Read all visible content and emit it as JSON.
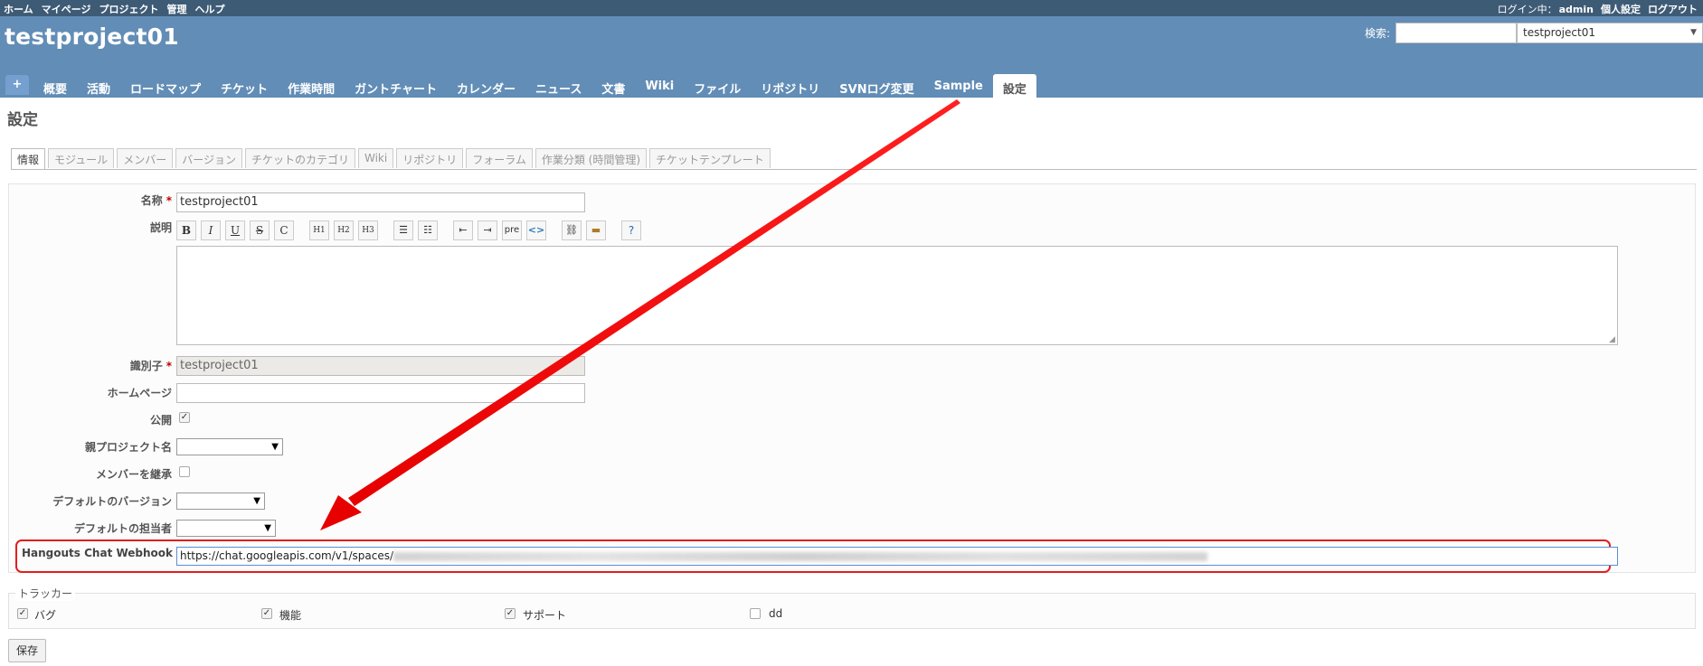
{
  "top_menu": {
    "items": [
      "ホーム",
      "マイページ",
      "プロジェクト",
      "管理",
      "ヘルプ"
    ],
    "login_text": "ログイン中：",
    "login_user": "admin",
    "my_account": "個人設定",
    "logout": "ログアウト"
  },
  "header": {
    "title": "testproject01",
    "search_label": "検索:",
    "search_value": "",
    "project_jump": "testproject01"
  },
  "main_menu": {
    "new_label": "+",
    "items": [
      "概要",
      "活動",
      "ロードマップ",
      "チケット",
      "作業時間",
      "ガントチャート",
      "カレンダー",
      "ニュース",
      "文書",
      "Wiki",
      "ファイル",
      "リポジトリ",
      "SVNログ変更",
      "Sample",
      "設定"
    ],
    "selected": "設定"
  },
  "page": {
    "title": "設定"
  },
  "tabs": {
    "items": [
      "情報",
      "モジュール",
      "メンバー",
      "バージョン",
      "チケットのカテゴリ",
      "Wiki",
      "リポジトリ",
      "フォーラム",
      "作業分類 (時間管理)",
      "チケットテンプレート"
    ],
    "selected": "情報"
  },
  "form": {
    "name": {
      "label": "名称",
      "required": "*",
      "value": "testproject01"
    },
    "description": {
      "label": "説明",
      "value": ""
    },
    "identifier": {
      "label": "識別子",
      "required": "*",
      "value": "testproject01"
    },
    "homepage": {
      "label": "ホームページ",
      "value": ""
    },
    "public": {
      "label": "公開",
      "checked": true
    },
    "parent": {
      "label": "親プロジェクト名",
      "value": ""
    },
    "inherit_members": {
      "label": "メンバーを継承",
      "checked": false
    },
    "default_version": {
      "label": "デフォルトのバージョン",
      "value": ""
    },
    "default_assignee": {
      "label": "デフォルトの担当者",
      "value": ""
    },
    "webhook": {
      "label": "Hangouts Chat Webhook",
      "value": "https://chat.googleapis.com/v1/spaces/"
    }
  },
  "toolbar": {
    "buttons": [
      "B",
      "I",
      "U",
      "S",
      "C",
      "H1",
      "H2",
      "H3",
      "ul",
      "ol",
      "indent-left",
      "indent-right",
      "pre",
      "code",
      "link",
      "image",
      "help"
    ]
  },
  "trackers": {
    "legend": "トラッカー",
    "items": [
      {
        "label": "バグ",
        "checked": true
      },
      {
        "label": "機能",
        "checked": true
      },
      {
        "label": "サポート",
        "checked": true
      },
      {
        "label": "dd",
        "checked": false
      }
    ]
  },
  "save_label": "保存",
  "colors": {
    "top_bar": "#3e5b76",
    "header": "#628db6",
    "annotation": "#e01f1f",
    "required": "#bb0000"
  }
}
